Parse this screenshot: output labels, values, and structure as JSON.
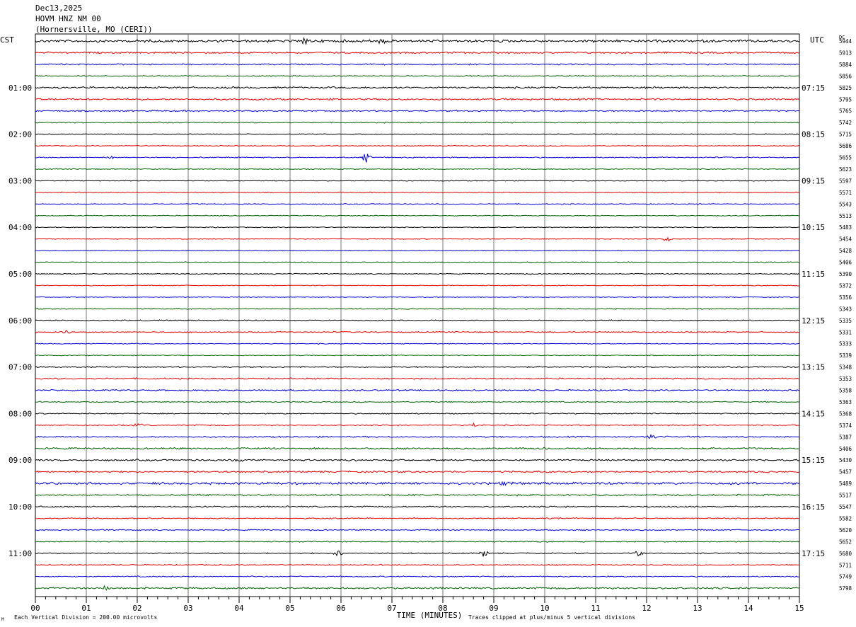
{
  "header": {
    "date": "Dec13,2025",
    "station": "HOVM HNZ NM 00",
    "location": "(Hornersville, MO (CERI))"
  },
  "left_timezone": "CST",
  "right_timezone": "UTC",
  "dc_label": "DC",
  "footer": {
    "scale_note": "Each Vertical Division =  200.00 microvolts",
    "clip_note": "Traces clipped at plus/minus 5 vertical divisions",
    "corner_mark": "M"
  },
  "colors": {
    "trace_cycle": [
      "#000000",
      "#e00000",
      "#0000d0",
      "#006400"
    ],
    "grid": "#777777"
  },
  "chart_data": {
    "type": "line",
    "xlabel": "TIME (MINUTES)",
    "x_ticks": [
      "00",
      "01",
      "02",
      "03",
      "04",
      "05",
      "06",
      "07",
      "08",
      "09",
      "10",
      "11",
      "12",
      "13",
      "14",
      "15"
    ],
    "xlim": [
      0,
      15
    ],
    "left_hour_labels": [
      "01:00",
      "02:00",
      "03:00",
      "04:00",
      "05:00",
      "06:00",
      "07:00",
      "08:00",
      "09:00",
      "10:00",
      "11:00"
    ],
    "right_hour_labels": [
      "07:15",
      "08:15",
      "09:15",
      "10:15",
      "11:15",
      "12:15",
      "13:15",
      "14:15",
      "15:15",
      "16:15",
      "17:15"
    ],
    "dc_offsets": [
      5944,
      5913,
      5884,
      5856,
      5825,
      5795,
      5765,
      5742,
      5715,
      5686,
      5655,
      5623,
      5597,
      5571,
      5543,
      5513,
      5483,
      5454,
      5428,
      5406,
      5390,
      5372,
      5356,
      5343,
      5335,
      5331,
      5333,
      5339,
      5348,
      5353,
      5358,
      5363,
      5368,
      5374,
      5387,
      5406,
      5430,
      5457,
      5489,
      5517,
      5547,
      5582,
      5620,
      5652,
      5680,
      5711,
      5749,
      5798
    ],
    "noise_level": [
      0.9,
      0.6,
      0.5,
      0.4,
      0.6,
      0.6,
      0.5,
      0.4,
      0.3,
      0.3,
      0.4,
      0.3,
      0.3,
      0.3,
      0.3,
      0.3,
      0.3,
      0.3,
      0.3,
      0.3,
      0.3,
      0.3,
      0.3,
      0.4,
      0.4,
      0.4,
      0.3,
      0.3,
      0.5,
      0.5,
      0.5,
      0.4,
      0.4,
      0.4,
      0.5,
      0.6,
      0.6,
      0.6,
      0.8,
      0.6,
      0.5,
      0.4,
      0.4,
      0.4,
      0.4,
      0.4,
      0.4,
      0.6
    ],
    "events": [
      {
        "trace": 0,
        "minute": 5.3,
        "amp": 5
      },
      {
        "trace": 0,
        "minute": 6.8,
        "amp": 4
      },
      {
        "trace": 10,
        "minute": 1.5,
        "amp": 3
      },
      {
        "trace": 10,
        "minute": 6.5,
        "amp": 9
      },
      {
        "trace": 17,
        "minute": 12.4,
        "amp": 5
      },
      {
        "trace": 25,
        "minute": 0.6,
        "amp": 3
      },
      {
        "trace": 33,
        "minute": 2.0,
        "amp": 3
      },
      {
        "trace": 33,
        "minute": 8.6,
        "amp": 3
      },
      {
        "trace": 34,
        "minute": 12.1,
        "amp": 4
      },
      {
        "trace": 35,
        "minute": 10.0,
        "amp": 3
      },
      {
        "trace": 36,
        "minute": 4.0,
        "amp": 3
      },
      {
        "trace": 38,
        "minute": 9.2,
        "amp": 4
      },
      {
        "trace": 44,
        "minute": 5.95,
        "amp": 6
      },
      {
        "trace": 44,
        "minute": 8.8,
        "amp": 6
      },
      {
        "trace": 44,
        "minute": 11.85,
        "amp": 5
      },
      {
        "trace": 47,
        "minute": 1.4,
        "amp": 4
      }
    ]
  }
}
